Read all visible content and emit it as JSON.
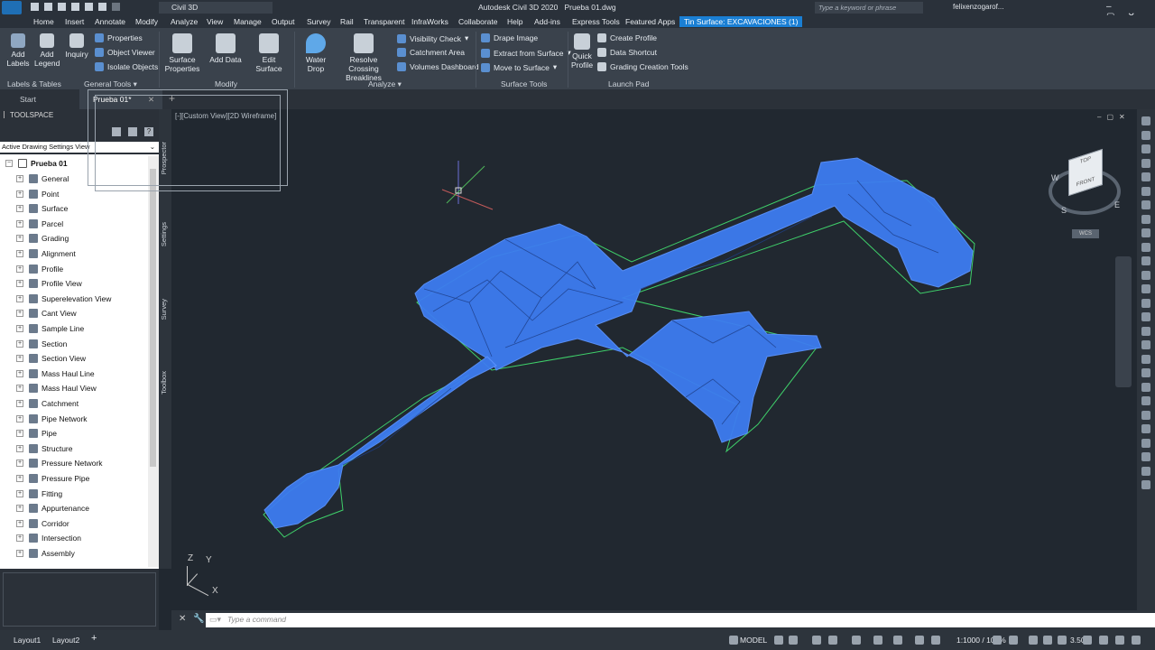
{
  "title": {
    "app": "Autodesk Civil 3D 2020",
    "file": "Prueba 01.dwg",
    "workspace": "Civil 3D",
    "search_placeholder": "Type a keyword or phrase",
    "user": "felixenzogarof..."
  },
  "menu": [
    "Home",
    "Insert",
    "Annotate",
    "Modify",
    "Analyze",
    "View",
    "Manage",
    "Output",
    "Survey",
    "Rail",
    "Transparent",
    "InfraWorks",
    "Collaborate",
    "Help",
    "Add-ins",
    "Express Tools",
    "Featured Apps"
  ],
  "context_tab": "Tin Surface: EXCAVACIONES (1)",
  "ribbon": {
    "labels_tables": {
      "add_labels": "Add Labels",
      "add_legend": "Add Legend",
      "inquiry": "Inquiry",
      "panel": "Labels & Tables"
    },
    "general_tools": {
      "properties": "Properties",
      "object_viewer": "Object Viewer",
      "isolate_objects": "Isolate Objects",
      "panel": "General Tools"
    },
    "modify": {
      "surface_properties": "Surface Properties",
      "add_data": "Add Data",
      "edit_surface": "Edit Surface",
      "panel": "Modify"
    },
    "analyze": {
      "water_drop": "Water Drop",
      "resolve_crossing": "Resolve Crossing Breaklines",
      "visibility_check": "Visibility Check",
      "catchment_area": "Catchment Area",
      "volumes_dashboard": "Volumes Dashboard",
      "panel": "Analyze"
    },
    "surface_tools": {
      "drape_image": "Drape Image",
      "extract_from_surface": "Extract from Surface",
      "move_to_surface": "Move to Surface",
      "panel": "Surface Tools"
    },
    "launch_pad": {
      "quick_profile": "Quick Profile",
      "create_profile": "Create Profile",
      "data_shortcut": "Data Shortcut",
      "grading_creation_tools": "Grading Creation Tools",
      "panel": "Launch Pad"
    }
  },
  "doc_tabs": [
    "Start",
    "Prueba 01*"
  ],
  "viewport_label": "[-][Custom View][2D Wireframe]",
  "toolspace": {
    "title": "TOOLSPACE",
    "view": "Active Drawing Settings View",
    "root": "Prueba 01",
    "items": [
      "General",
      "Point",
      "Surface",
      "Parcel",
      "Grading",
      "Alignment",
      "Profile",
      "Profile View",
      "Superelevation View",
      "Cant View",
      "Sample Line",
      "Section",
      "Section View",
      "Mass Haul Line",
      "Mass Haul View",
      "Catchment",
      "Pipe Network",
      "Pipe",
      "Structure",
      "Pressure Network",
      "Pressure Pipe",
      "Fitting",
      "Appurtenance",
      "Corridor",
      "Intersection",
      "Assembly"
    ],
    "side_tabs": [
      "Prospector",
      "Settings",
      "Survey",
      "Toolbox"
    ]
  },
  "viewcube": {
    "top": "TOP",
    "front": "FRONT",
    "compass": [
      "W",
      "S",
      "E"
    ],
    "wcs": "WCS"
  },
  "ucs": {
    "x": "X",
    "y": "Y",
    "z": "Z"
  },
  "command": {
    "placeholder": "Type a command"
  },
  "layouts": [
    "Layout1",
    "Layout2"
  ],
  "status": {
    "model": "MODEL",
    "scale": "1:1000 / 100%",
    "value": "3.500"
  },
  "colors": {
    "surface": "#3d7cf0",
    "boundary": "#3fd06a",
    "viewport_bg": "#212830"
  }
}
